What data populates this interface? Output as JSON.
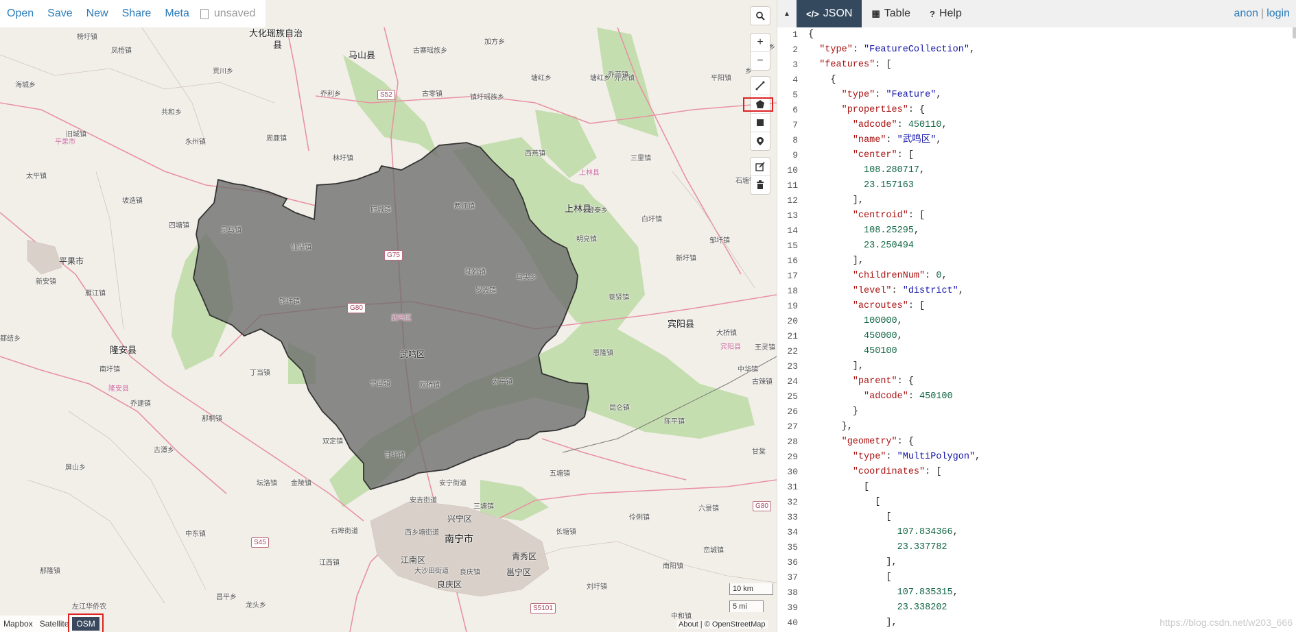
{
  "menu": {
    "open": "Open",
    "save": "Save",
    "new": "New",
    "share": "Share",
    "meta": "Meta",
    "status": "unsaved"
  },
  "map": {
    "places": [
      {
        "t": "大化瑶族自治",
        "c": "lg"
      },
      {
        "t": "县",
        "c": "lg"
      },
      {
        "t": "马山县",
        "c": "lg"
      },
      {
        "t": "加方乡",
        "c": "sm"
      },
      {
        "t": "古寨瑶族乡",
        "c": "sm"
      },
      {
        "t": "古零镇",
        "c": "sm"
      },
      {
        "t": "乔利乡",
        "c": "sm"
      },
      {
        "t": "镇圩瑶族乡",
        "c": "sm"
      },
      {
        "t": "塘红乡",
        "c": "sm"
      },
      {
        "t": "乔贤镇",
        "c": "sm"
      },
      {
        "t": "平果市",
        "c": "pink"
      },
      {
        "t": "榜圩镇",
        "c": "sm"
      },
      {
        "t": "凤梧镇",
        "c": "sm"
      },
      {
        "t": "贡川乡",
        "c": "sm"
      },
      {
        "t": "海城乡",
        "c": "sm"
      },
      {
        "t": "共和乡",
        "c": "sm"
      },
      {
        "t": "旧城镇",
        "c": "sm"
      },
      {
        "t": "永州镇",
        "c": "sm"
      },
      {
        "t": "周鹿镇",
        "c": "sm"
      },
      {
        "t": "林圩镇",
        "c": "sm"
      },
      {
        "t": "太平镇",
        "c": "sm"
      },
      {
        "t": "坡造镇",
        "c": "sm"
      },
      {
        "t": "四塘镇",
        "c": "sm"
      },
      {
        "t": "灵马镇",
        "c": "sm"
      },
      {
        "t": "府城镇",
        "c": "sm"
      },
      {
        "t": "两江镇",
        "c": "sm"
      },
      {
        "t": "仙湖镇",
        "c": "sm"
      },
      {
        "t": "陆斡镇",
        "c": "sm"
      },
      {
        "t": "马头乡",
        "c": "sm"
      },
      {
        "t": "罗波镇",
        "c": "sm"
      },
      {
        "t": "锣圩镇",
        "c": "sm"
      },
      {
        "t": "武鸣区",
        "c": "pink"
      },
      {
        "t": "武鸣区",
        "c": "md"
      },
      {
        "t": "平果市",
        "c": "md"
      },
      {
        "t": "新安镇",
        "c": "sm"
      },
      {
        "t": "雁江镇",
        "c": "sm"
      },
      {
        "t": "都结乡",
        "c": "sm"
      },
      {
        "t": "隆安县",
        "c": "lg"
      },
      {
        "t": "南圩镇",
        "c": "sm"
      },
      {
        "t": "隆安县",
        "c": "pink"
      },
      {
        "t": "乔建镇",
        "c": "sm"
      },
      {
        "t": "那桐镇",
        "c": "sm"
      },
      {
        "t": "丁当镇",
        "c": "sm"
      },
      {
        "t": "宁武镇",
        "c": "sm"
      },
      {
        "t": "双桥镇",
        "c": "sm"
      },
      {
        "t": "太平镇",
        "c": "sm"
      },
      {
        "t": "双定镇",
        "c": "sm"
      },
      {
        "t": "古潭乡",
        "c": "sm"
      },
      {
        "t": "屏山乡",
        "c": "sm"
      },
      {
        "t": "甘圩镇",
        "c": "sm"
      },
      {
        "t": "坛洛镇",
        "c": "sm"
      },
      {
        "t": "金陵镇",
        "c": "sm"
      },
      {
        "t": "安宁街道",
        "c": "sm"
      },
      {
        "t": "安吉街道",
        "c": "sm"
      },
      {
        "t": "三塘镇",
        "c": "sm"
      },
      {
        "t": "兴宁区",
        "c": "md"
      },
      {
        "t": "西乡塘街道",
        "c": "sm"
      },
      {
        "t": "石埠街道",
        "c": "sm"
      },
      {
        "t": "南宁市",
        "c": "city"
      },
      {
        "t": "青秀区",
        "c": "md"
      },
      {
        "t": "江南区",
        "c": "md"
      },
      {
        "t": "大沙田街道",
        "c": "sm"
      },
      {
        "t": "良庆镇",
        "c": "sm"
      },
      {
        "t": "邕宁区",
        "c": "md"
      },
      {
        "t": "良庆区",
        "c": "md"
      },
      {
        "t": "江西镇",
        "c": "sm"
      },
      {
        "t": "中东镇",
        "c": "sm"
      },
      {
        "t": "那隆镇",
        "c": "sm"
      },
      {
        "t": "昌平乡",
        "c": "sm"
      },
      {
        "t": "左江华侨农",
        "c": "sm"
      },
      {
        "t": "龙头乡",
        "c": "sm"
      },
      {
        "t": "刘圩镇",
        "c": "sm"
      },
      {
        "t": "南阳镇",
        "c": "sm"
      },
      {
        "t": "中和镇",
        "c": "sm"
      },
      {
        "t": "长塘镇",
        "c": "sm"
      },
      {
        "t": "伶俐镇",
        "c": "sm"
      },
      {
        "t": "六景镇",
        "c": "sm"
      },
      {
        "t": "峦城镇",
        "c": "sm"
      },
      {
        "t": "陈平镇",
        "c": "sm"
      },
      {
        "t": "昆仑镇",
        "c": "sm"
      },
      {
        "t": "五塘镇",
        "c": "sm"
      },
      {
        "t": "恩隆镇",
        "c": "sm"
      },
      {
        "t": "宾阳县",
        "c": "lg"
      },
      {
        "t": "宾阳县",
        "c": "pink"
      },
      {
        "t": "大桥镇",
        "c": "sm"
      },
      {
        "t": "中华镇",
        "c": "sm"
      },
      {
        "t": "古辣镇",
        "c": "sm"
      },
      {
        "t": "王灵镇",
        "c": "sm"
      },
      {
        "t": "巷贤镇",
        "c": "sm"
      },
      {
        "t": "新圩镇",
        "c": "sm"
      },
      {
        "t": "白圩镇",
        "c": "sm"
      },
      {
        "t": "邹圩镇",
        "c": "sm"
      },
      {
        "t": "明亮镇",
        "c": "sm"
      },
      {
        "t": "澄泰乡",
        "c": "sm"
      },
      {
        "t": "上林县",
        "c": "lg"
      },
      {
        "t": "上林县",
        "c": "pink"
      },
      {
        "t": "三里镇",
        "c": "sm"
      },
      {
        "t": "西燕镇",
        "c": "sm"
      },
      {
        "t": "平阳镇",
        "c": "sm"
      },
      {
        "t": "石塘镇",
        "c": "sm"
      },
      {
        "t": "乔苗镇",
        "c": "sm"
      },
      {
        "t": "塘红乡",
        "c": "sm"
      },
      {
        "t": "甘棠",
        "c": "sm"
      },
      {
        "t": "大化乡",
        "c": "sm"
      },
      {
        "t": "乡",
        "c": "sm"
      }
    ],
    "shields": [
      "S52",
      "G75",
      "G80",
      "S45",
      "S5101",
      "G80"
    ],
    "scale_km": "10 km",
    "scale_mi": "5 mi",
    "attribution": "About | © OpenStreetMap",
    "layers": [
      "Mapbox",
      "Satellite",
      "OSM"
    ],
    "active_layer": "OSM",
    "colors": {
      "polygon_fill": "#6b6b6b",
      "polygon_stroke": "#333333",
      "park": "#b8d9a4",
      "road": "#e892a2",
      "highlight": "#dd2222"
    }
  },
  "panel": {
    "tabs": [
      "JSON",
      "Table",
      "Help"
    ],
    "active_tab": "JSON",
    "user": {
      "anon": "anon",
      "sep": "|",
      "login": "login"
    },
    "watermark": "https://blog.csdn.net/w203_666",
    "code": [
      [
        [
          "p",
          "{"
        ]
      ],
      [
        [
          "p",
          "  "
        ],
        [
          "k",
          "\"type\""
        ],
        [
          "p",
          ": "
        ],
        [
          "s",
          "\"FeatureCollection\""
        ],
        [
          "p",
          ","
        ]
      ],
      [
        [
          "p",
          "  "
        ],
        [
          "k",
          "\"features\""
        ],
        [
          "p",
          ": ["
        ]
      ],
      [
        [
          "p",
          "    {"
        ]
      ],
      [
        [
          "p",
          "      "
        ],
        [
          "k",
          "\"type\""
        ],
        [
          "p",
          ": "
        ],
        [
          "s",
          "\"Feature\""
        ],
        [
          "p",
          ","
        ]
      ],
      [
        [
          "p",
          "      "
        ],
        [
          "k",
          "\"properties\""
        ],
        [
          "p",
          ": {"
        ]
      ],
      [
        [
          "p",
          "        "
        ],
        [
          "k",
          "\"adcode\""
        ],
        [
          "p",
          ": "
        ],
        [
          "n",
          "450110"
        ],
        [
          "p",
          ","
        ]
      ],
      [
        [
          "p",
          "        "
        ],
        [
          "k",
          "\"name\""
        ],
        [
          "p",
          ": "
        ],
        [
          "s",
          "\"武鸣区\""
        ],
        [
          "p",
          ","
        ]
      ],
      [
        [
          "p",
          "        "
        ],
        [
          "k",
          "\"center\""
        ],
        [
          "p",
          ": ["
        ]
      ],
      [
        [
          "p",
          "          "
        ],
        [
          "n",
          "108.280717"
        ],
        [
          "p",
          ","
        ]
      ],
      [
        [
          "p",
          "          "
        ],
        [
          "n",
          "23.157163"
        ]
      ],
      [
        [
          "p",
          "        ],"
        ]
      ],
      [
        [
          "p",
          "        "
        ],
        [
          "k",
          "\"centroid\""
        ],
        [
          "p",
          ": ["
        ]
      ],
      [
        [
          "p",
          "          "
        ],
        [
          "n",
          "108.25295"
        ],
        [
          "p",
          ","
        ]
      ],
      [
        [
          "p",
          "          "
        ],
        [
          "n",
          "23.250494"
        ]
      ],
      [
        [
          "p",
          "        ],"
        ]
      ],
      [
        [
          "p",
          "        "
        ],
        [
          "k",
          "\"childrenNum\""
        ],
        [
          "p",
          ": "
        ],
        [
          "n",
          "0"
        ],
        [
          "p",
          ","
        ]
      ],
      [
        [
          "p",
          "        "
        ],
        [
          "k",
          "\"level\""
        ],
        [
          "p",
          ": "
        ],
        [
          "s",
          "\"district\""
        ],
        [
          "p",
          ","
        ]
      ],
      [
        [
          "p",
          "        "
        ],
        [
          "k",
          "\"acroutes\""
        ],
        [
          "p",
          ": ["
        ]
      ],
      [
        [
          "p",
          "          "
        ],
        [
          "n",
          "100000"
        ],
        [
          "p",
          ","
        ]
      ],
      [
        [
          "p",
          "          "
        ],
        [
          "n",
          "450000"
        ],
        [
          "p",
          ","
        ]
      ],
      [
        [
          "p",
          "          "
        ],
        [
          "n",
          "450100"
        ]
      ],
      [
        [
          "p",
          "        ],"
        ]
      ],
      [
        [
          "p",
          "        "
        ],
        [
          "k",
          "\"parent\""
        ],
        [
          "p",
          ": {"
        ]
      ],
      [
        [
          "p",
          "          "
        ],
        [
          "k",
          "\"adcode\""
        ],
        [
          "p",
          ": "
        ],
        [
          "n",
          "450100"
        ]
      ],
      [
        [
          "p",
          "        }"
        ]
      ],
      [
        [
          "p",
          "      },"
        ]
      ],
      [
        [
          "p",
          "      "
        ],
        [
          "k",
          "\"geometry\""
        ],
        [
          "p",
          ": {"
        ]
      ],
      [
        [
          "p",
          "        "
        ],
        [
          "k",
          "\"type\""
        ],
        [
          "p",
          ": "
        ],
        [
          "s",
          "\"MultiPolygon\""
        ],
        [
          "p",
          ","
        ]
      ],
      [
        [
          "p",
          "        "
        ],
        [
          "k",
          "\"coordinates\""
        ],
        [
          "p",
          ": ["
        ]
      ],
      [
        [
          "p",
          "          ["
        ]
      ],
      [
        [
          "p",
          "            ["
        ]
      ],
      [
        [
          "p",
          "              ["
        ]
      ],
      [
        [
          "p",
          "                "
        ],
        [
          "n",
          "107.834366"
        ],
        [
          "p",
          ","
        ]
      ],
      [
        [
          "p",
          "                "
        ],
        [
          "n",
          "23.337782"
        ]
      ],
      [
        [
          "p",
          "              ],"
        ]
      ],
      [
        [
          "p",
          "              ["
        ]
      ],
      [
        [
          "p",
          "                "
        ],
        [
          "n",
          "107.835315"
        ],
        [
          "p",
          ","
        ]
      ],
      [
        [
          "p",
          "                "
        ],
        [
          "n",
          "23.338202"
        ]
      ],
      [
        [
          "p",
          "              ],"
        ]
      ]
    ]
  }
}
